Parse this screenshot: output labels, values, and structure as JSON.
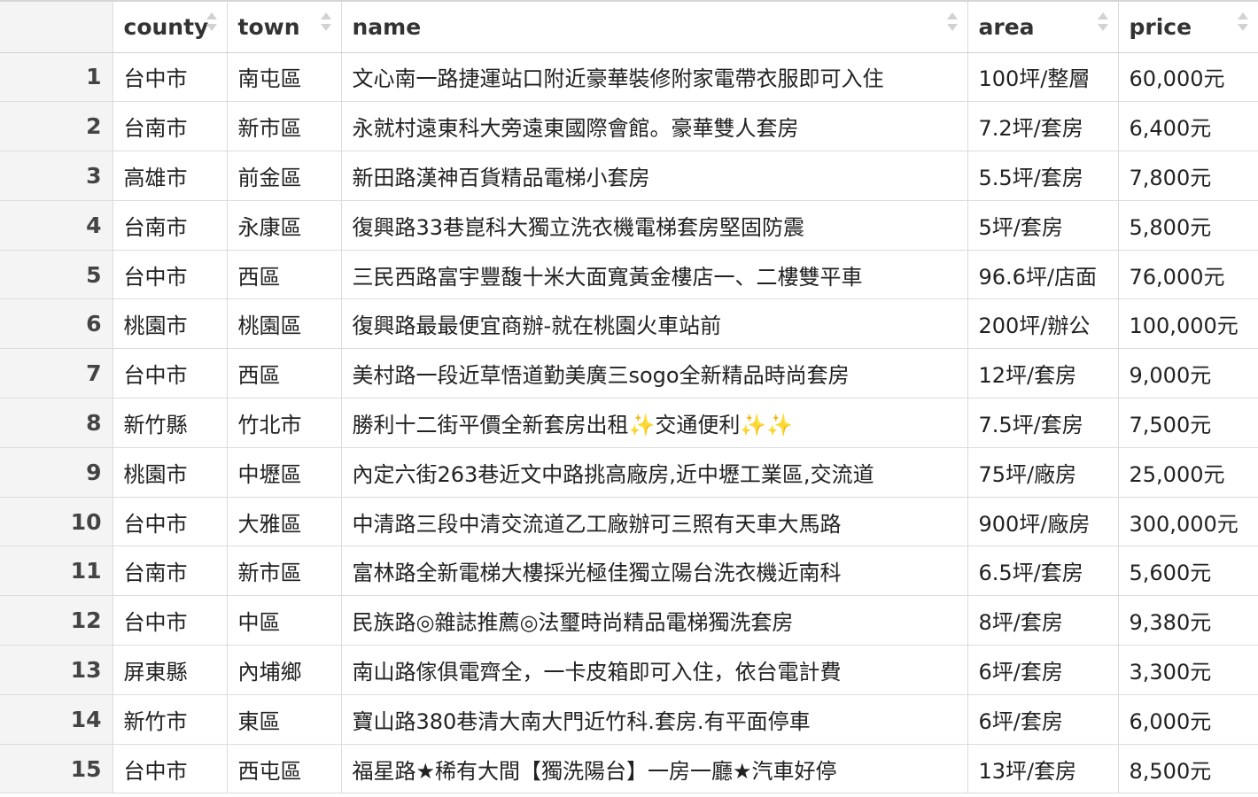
{
  "table": {
    "columns": [
      "county",
      "town",
      "name",
      "area",
      "price"
    ],
    "rows": [
      {
        "index": "1",
        "county": "台中市",
        "town": "南屯區",
        "name": "文心南一路捷運站口附近豪華裝修附家電帶衣服即可入住",
        "area": "100坪/整層",
        "price": "60,000元"
      },
      {
        "index": "2",
        "county": "台南市",
        "town": "新市區",
        "name": "永就村遠東科大旁遠東國際會館。豪華雙人套房",
        "area": "7.2坪/套房",
        "price": "6,400元"
      },
      {
        "index": "3",
        "county": "高雄市",
        "town": "前金區",
        "name": "新田路漢神百貨精品電梯小套房",
        "area": "5.5坪/套房",
        "price": "7,800元"
      },
      {
        "index": "4",
        "county": "台南市",
        "town": "永康區",
        "name": "復興路33巷崑科大獨立洗衣機電梯套房堅固防震",
        "area": "5坪/套房",
        "price": "5,800元"
      },
      {
        "index": "5",
        "county": "台中市",
        "town": "西區",
        "name": "三民西路富宇豐馥十米大面寬黃金樓店一、二樓雙平車",
        "area": "96.6坪/店面",
        "price": "76,000元"
      },
      {
        "index": "6",
        "county": "桃園市",
        "town": "桃園區",
        "name": "復興路最最便宜商辦-就在桃園火車站前",
        "area": "200坪/辦公",
        "price": "100,000元"
      },
      {
        "index": "7",
        "county": "台中市",
        "town": "西區",
        "name": "美村路一段近草悟道勤美廣三sogo全新精品時尚套房",
        "area": "12坪/套房",
        "price": "9,000元"
      },
      {
        "index": "8",
        "county": "新竹縣",
        "town": "竹北市",
        "name": "勝利十二街平價全新套房出租✨交通便利✨✨",
        "area": "7.5坪/套房",
        "price": "7,500元"
      },
      {
        "index": "9",
        "county": "桃園市",
        "town": "中壢區",
        "name": "內定六街263巷近文中路挑高廠房,近中壢工業區,交流道",
        "area": "75坪/廠房",
        "price": "25,000元"
      },
      {
        "index": "10",
        "county": "台中市",
        "town": "大雅區",
        "name": "中清路三段中清交流道乙工廠辦可三照有天車大馬路",
        "area": "900坪/廠房",
        "price": "300,000元"
      },
      {
        "index": "11",
        "county": "台南市",
        "town": "新市區",
        "name": "富林路全新電梯大樓採光極佳獨立陽台洗衣機近南科",
        "area": "6.5坪/套房",
        "price": "5,600元"
      },
      {
        "index": "12",
        "county": "台中市",
        "town": "中區",
        "name": "民族路◎雜誌推薦◎法璽時尚精品電梯獨洗套房",
        "area": "8坪/套房",
        "price": "9,380元"
      },
      {
        "index": "13",
        "county": "屏東縣",
        "town": "內埔鄉",
        "name": "南山路傢俱電齊全，一卡皮箱即可入住，依台電計費",
        "area": "6坪/套房",
        "price": "3,300元"
      },
      {
        "index": "14",
        "county": "新竹市",
        "town": "東區",
        "name": "寶山路380巷清大南大門近竹科.套房.有平面停車",
        "area": "6坪/套房",
        "price": "6,000元"
      },
      {
        "index": "15",
        "county": "台中市",
        "town": "西屯區",
        "name": "福星路★稀有大間【獨洗陽台】一房一廳★汽車好停",
        "area": "13坪/套房",
        "price": "8,500元"
      }
    ]
  },
  "colors": {
    "index_background": "#f4f4f4",
    "grid_line": "#dcdcdc",
    "sort_arrow": "#d2d2d2"
  }
}
